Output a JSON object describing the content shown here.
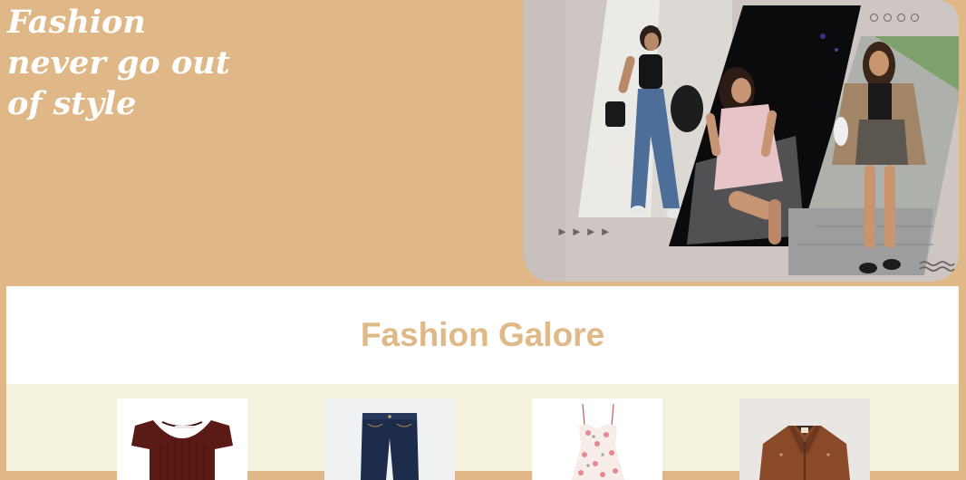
{
  "hero": {
    "line1": "Fashion",
    "line2": "never go out",
    "line3": "of style"
  },
  "collage": {
    "photos": [
      {
        "icon": "photo-woman-jeans"
      },
      {
        "icon": "photo-woman-dress-night"
      },
      {
        "icon": "photo-woman-jacket-street"
      }
    ],
    "arrows_text": "►►►►",
    "dots_icon": "pagination-dots-icon",
    "waves_icon": "waves-icon"
  },
  "section": {
    "title": "Fashion Galore"
  },
  "products": [
    {
      "icon": "knit-top-icon"
    },
    {
      "icon": "jeans-icon"
    },
    {
      "icon": "floral-dress-icon"
    },
    {
      "icon": "leather-jacket-icon"
    }
  ],
  "colors": {
    "background": "#e0b887",
    "title": "#dfb987",
    "collage": "#cdc6c3",
    "product_strip": "#f5f3de"
  }
}
